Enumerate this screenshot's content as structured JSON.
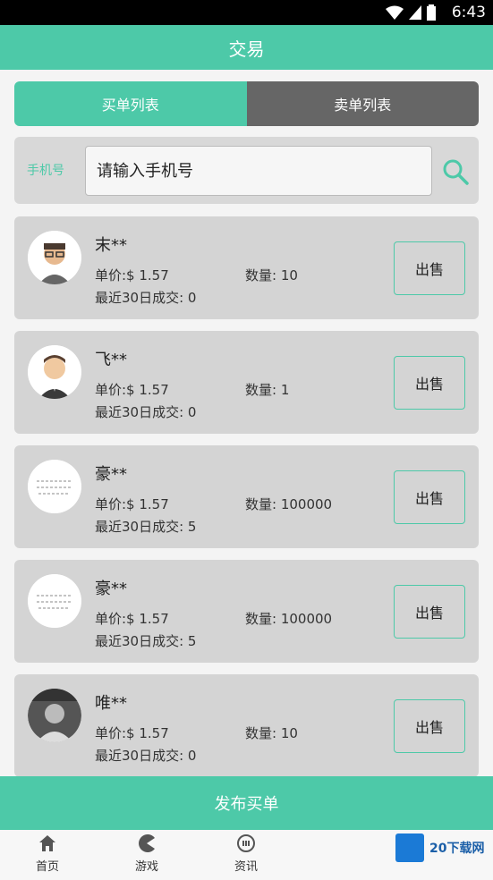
{
  "status_bar": {
    "time": "6:43"
  },
  "header": {
    "title": "交易"
  },
  "tabs": [
    {
      "label": "买单列表",
      "active": true
    },
    {
      "label": "卖单列表",
      "active": false
    }
  ],
  "search": {
    "label": "手机号",
    "placeholder": "请输入手机号"
  },
  "orders": [
    {
      "name": "末**",
      "price": "单价:$ 1.57",
      "qty": "数量: 10",
      "recent": "最近30日成交: 0",
      "sell": "出售"
    },
    {
      "name": "飞**",
      "price": "单价:$ 1.57",
      "qty": "数量: 1",
      "recent": "最近30日成交: 0",
      "sell": "出售"
    },
    {
      "name": "豪**",
      "price": "单价:$ 1.57",
      "qty": "数量: 100000",
      "recent": "最近30日成交: 5",
      "sell": "出售"
    },
    {
      "name": "豪**",
      "price": "单价:$ 1.57",
      "qty": "数量: 100000",
      "recent": "最近30日成交: 5",
      "sell": "出售"
    },
    {
      "name": "唯**",
      "price": "单价:$ 1.57",
      "qty": "数量: 10",
      "recent": "最近30日成交: 0",
      "sell": "出售"
    }
  ],
  "publish_button": "发布买单",
  "bottom_nav": [
    {
      "label": "首页",
      "icon": "home-icon"
    },
    {
      "label": "游戏",
      "icon": "pacman-icon"
    },
    {
      "label": "资讯",
      "icon": "news-icon"
    }
  ],
  "watermark": "20下载网",
  "colors": {
    "accent": "#4dc9a8",
    "tab_inactive": "#666666",
    "card": "#d4d4d4"
  }
}
